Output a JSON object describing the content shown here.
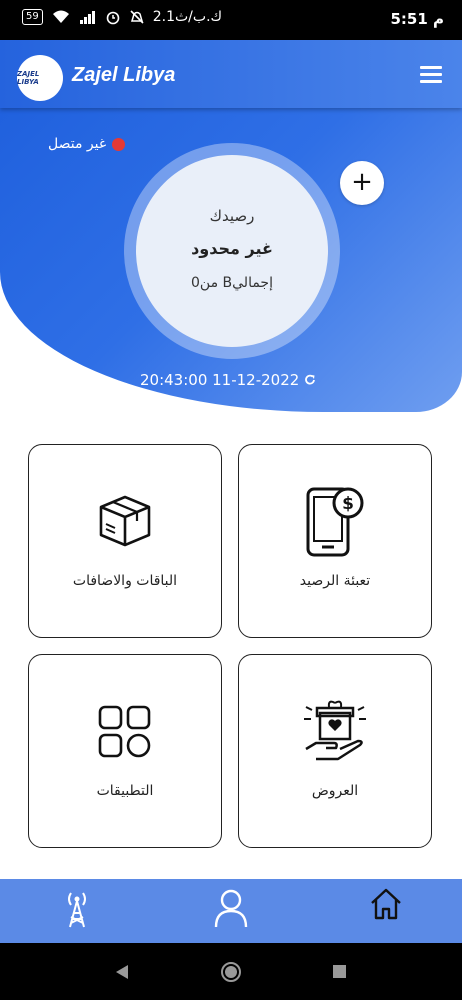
{
  "statusbar": {
    "time": "5:51 م",
    "battery": "59",
    "speed": "2.1ك.ب/ث"
  },
  "appbar": {
    "logo_text": "ZAJEL LIBYA",
    "brand": "Zajel Libya",
    "menu_icon": "hamburger-menu-icon"
  },
  "connection": {
    "status": "غير متصل",
    "color": "#e53935"
  },
  "balance": {
    "label": "رصيدك",
    "value": "غير محدود",
    "total": "من0 Bإجمالي"
  },
  "last_updated": "20:43:00 11-12-2022",
  "cards": {
    "recharge": "تعبئة الرصيد",
    "bundles": "الباقات والاضافات",
    "offers": "العروض",
    "apps": "التطبيقات"
  },
  "colors": {
    "primary": "#2563dd",
    "nav": "#5b8ae6"
  }
}
